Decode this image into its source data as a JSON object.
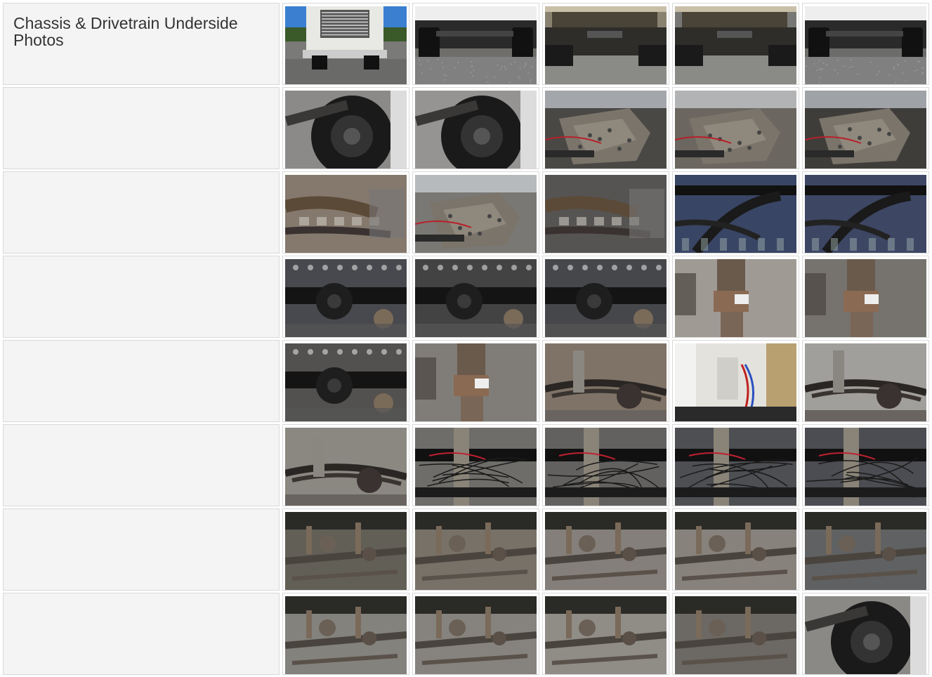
{
  "section": {
    "title": "Chassis & Drivetrain Underside Photos"
  },
  "rows": [
    {
      "thumbs": [
        {
          "name": "truck-front-bumper-photo",
          "scene": "truck-front",
          "bg": "#7a7a78"
        },
        {
          "name": "front-axle-low-angle-photo",
          "scene": "under-wide",
          "bg": "#6f6e6a"
        },
        {
          "name": "front-crossmember-photo",
          "scene": "under-frame",
          "bg": "#8a8270"
        },
        {
          "name": "rear-chassis-crossmember-photo",
          "scene": "under-frame",
          "bg": "#777775"
        },
        {
          "name": "rear-tandem-axle-photo",
          "scene": "under-wide",
          "bg": "#6c6c6a"
        }
      ]
    },
    {
      "thumbs": [
        {
          "name": "front-wheel-hub-photo",
          "scene": "wheel",
          "bg": "#5a5855"
        },
        {
          "name": "steering-linkage-wheel-photo",
          "scene": "wheel",
          "bg": "#6a6866"
        },
        {
          "name": "transmission-underside-photo",
          "scene": "gearbox",
          "bg": "#4a4845"
        },
        {
          "name": "gearbox-casing-photo",
          "scene": "gearbox",
          "bg": "#6b6660"
        },
        {
          "name": "gearbox-wiring-photo",
          "scene": "gearbox",
          "bg": "#3f3d3a"
        }
      ]
    },
    {
      "thumbs": [
        {
          "name": "exhaust-pipe-section-photo",
          "scene": "pipe",
          "bg": "#6a5a4a"
        },
        {
          "name": "driveshaft-coupling-photo",
          "scene": "gearbox",
          "bg": "#7a7874"
        },
        {
          "name": "driveshaft-tube-photo",
          "scene": "pipe",
          "bg": "#2a2826"
        },
        {
          "name": "rear-differential-frame-photo",
          "scene": "frame-blue",
          "bg": "#283248"
        },
        {
          "name": "rear-differential-spring-photo",
          "scene": "frame-blue",
          "bg": "#2f3548"
        }
      ]
    },
    {
      "thumbs": [
        {
          "name": "rear-axle-housing-photo",
          "scene": "axle",
          "bg": "#2c2e34"
        },
        {
          "name": "propshaft-center-bearing-photo",
          "scene": "axle",
          "bg": "#262626"
        },
        {
          "name": "differential-carrier-photo",
          "scene": "axle",
          "bg": "#2a2b30"
        },
        {
          "name": "universal-joint-photo",
          "scene": "ujoint",
          "bg": "#8a8580"
        },
        {
          "name": "interaxle-differential-photo",
          "scene": "ujoint",
          "bg": "#4a4744"
        }
      ]
    },
    {
      "thumbs": [
        {
          "name": "differential-pinion-photo",
          "scene": "axle",
          "bg": "#3a3835"
        },
        {
          "name": "rear-differential-housing-photo",
          "scene": "ujoint",
          "bg": "#5a5854"
        },
        {
          "name": "leaf-spring-shock-photo",
          "scene": "spring",
          "bg": "#5a4a3c"
        },
        {
          "name": "cab-rear-airlines-photo",
          "scene": "cab",
          "bg": "#b8b6b0"
        },
        {
          "name": "chassis-rail-side-photo",
          "scene": "spring",
          "bg": "#8a8886"
        }
      ]
    },
    {
      "thumbs": [
        {
          "name": "rear-suspension-rail-photo",
          "scene": "spring",
          "bg": "#6a6762"
        },
        {
          "name": "chassis-frame-rail-photo",
          "scene": "frame-wire",
          "bg": "#4a4844"
        },
        {
          "name": "battery-box-cables-photo",
          "scene": "frame-wire",
          "bg": "#3a3836"
        },
        {
          "name": "fluid-reservoir-wiring-photo",
          "scene": "frame-wire",
          "bg": "#1e2026"
        },
        {
          "name": "frame-wiring-harness-photo",
          "scene": "frame-wire",
          "bg": "#1c1e24"
        }
      ]
    },
    {
      "thumbs": [
        {
          "name": "front-steering-box-photo",
          "scene": "steer",
          "bg": "#3c3a30"
        },
        {
          "name": "front-suspension-link-photo",
          "scene": "steer",
          "bg": "#5a5248"
        },
        {
          "name": "front-axle-beam-photo",
          "scene": "steer",
          "bg": "#6a6460"
        },
        {
          "name": "steering-drag-link-photo",
          "scene": "steer",
          "bg": "#6e6862"
        },
        {
          "name": "front-sway-bar-photo",
          "scene": "steer",
          "bg": "#3a3c40"
        }
      ]
    },
    {
      "thumbs": [
        {
          "name": "front-axle-spring-photo",
          "scene": "steer",
          "bg": "#6a6864"
        },
        {
          "name": "brake-chamber-photo",
          "scene": "steer",
          "bg": "#6c6a66"
        },
        {
          "name": "tie-rod-end-photo",
          "scene": "steer",
          "bg": "#7a7670"
        },
        {
          "name": "spring-shackle-bolts-photo",
          "scene": "steer",
          "bg": "#4a4642"
        },
        {
          "name": "rear-tyre-frame-photo",
          "scene": "wheel",
          "bg": "#5a5652"
        }
      ]
    }
  ]
}
